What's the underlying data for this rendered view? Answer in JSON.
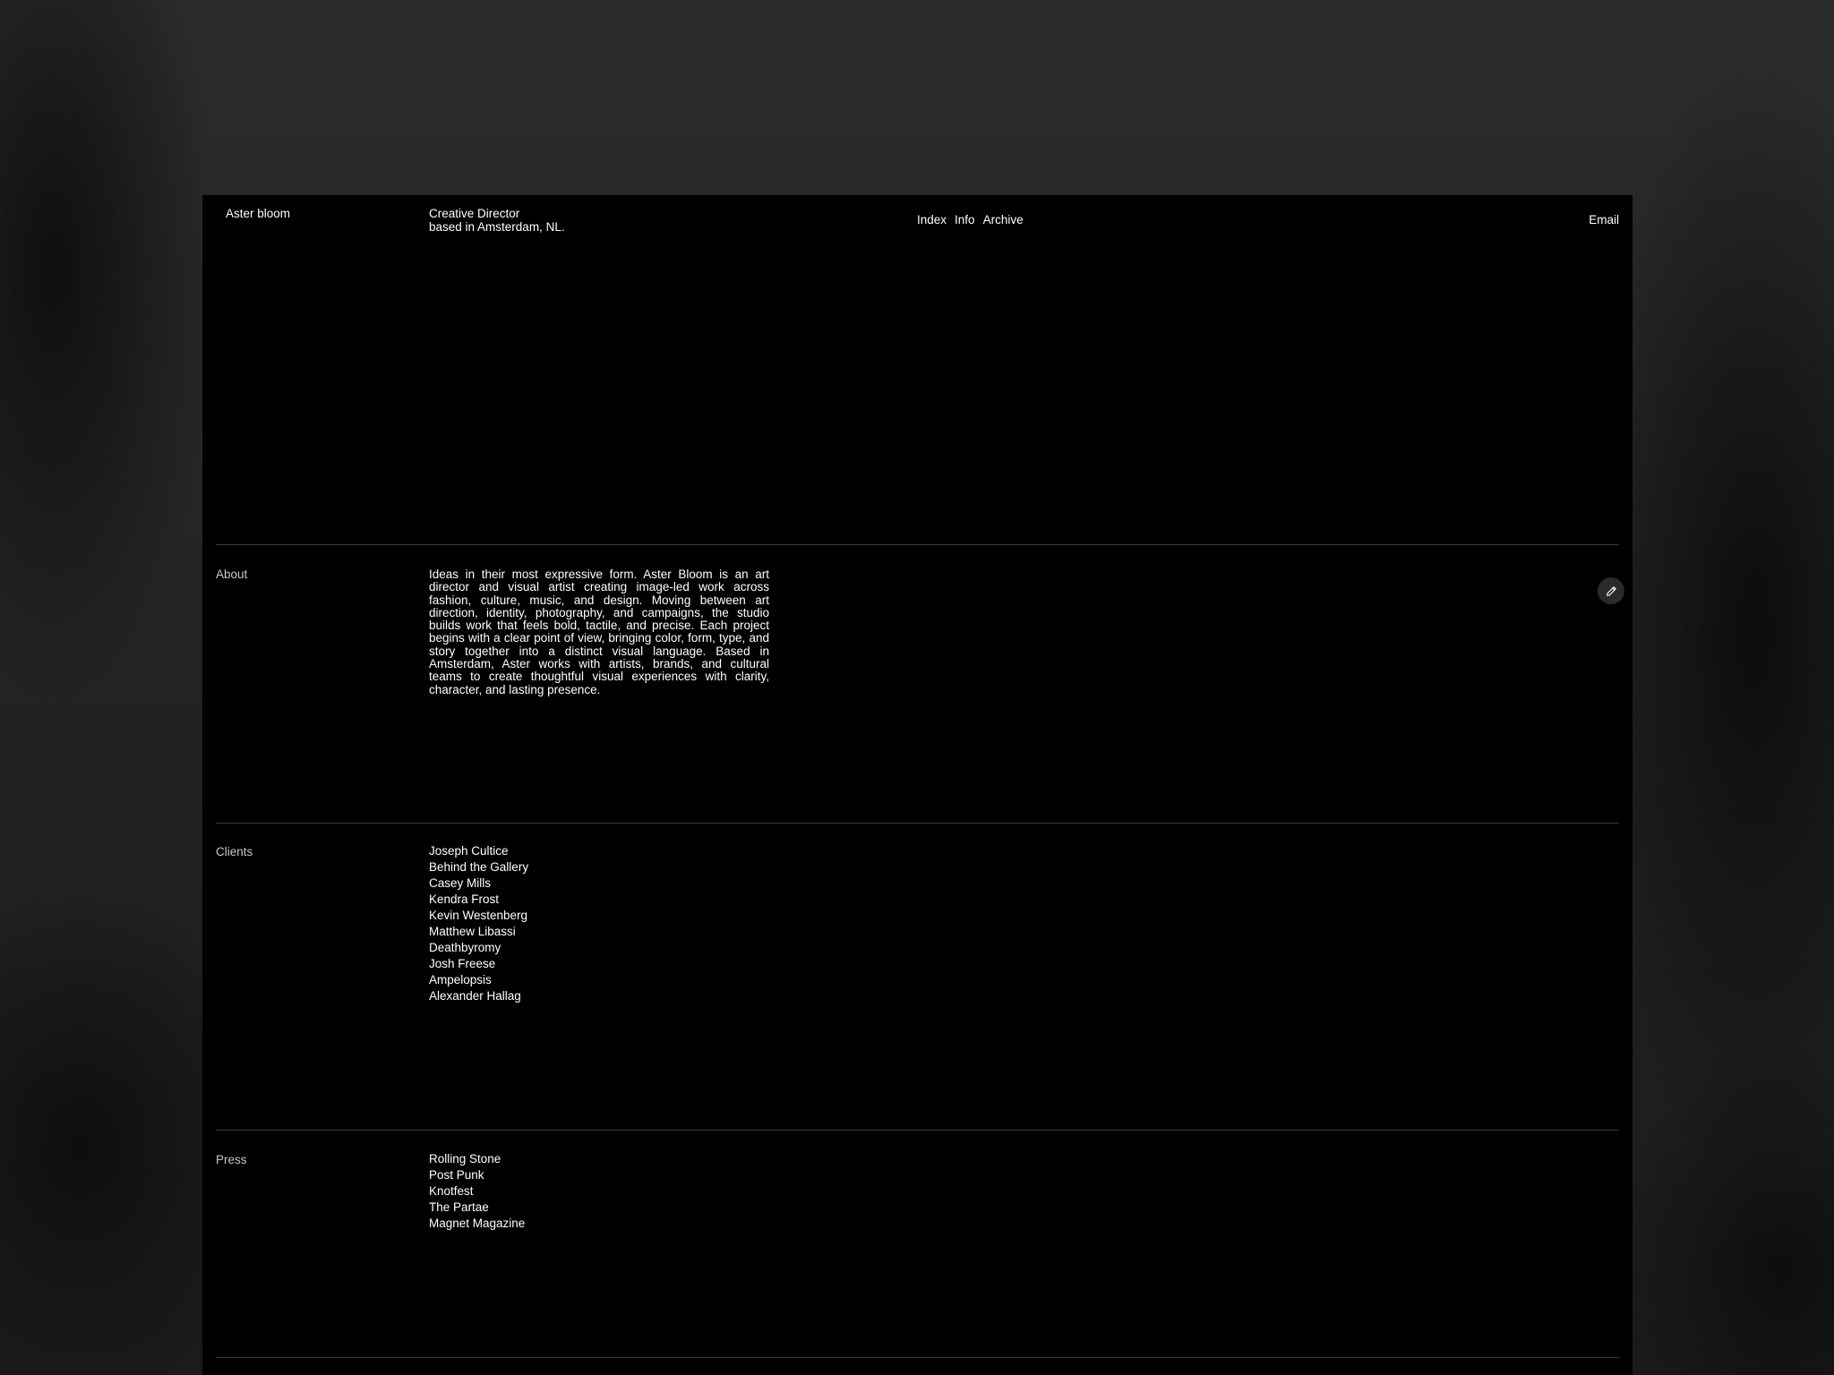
{
  "header": {
    "brand": "Aster bloom",
    "role_line1": "Creative Director",
    "role_line2": "based in Amsterdam, NL.",
    "nav": [
      "Index",
      "Info",
      "Archive"
    ],
    "email_label": "Email"
  },
  "about": {
    "label": "About",
    "text": "Ideas in their most expressive form. Aster Bloom is an art director and visual artist creating image-led work across fashion, culture, music, and design. Moving between art direction, identity, photography, and campaigns, the studio builds work that feels bold, tactile, and precise. Each project begins with a clear point of view, bringing color, form, type, and story together into a distinct visual language.  Based in Amsterdam, Aster works with artists, brands, and cultural teams to create thoughtful visual experiences with clarity, character, and lasting presence.",
    "edit_icon": "pencil-icon"
  },
  "clients": {
    "label": "Clients",
    "items": [
      "Joseph Cultice",
      "Behind the Gallery",
      "Casey Mills",
      "Kendra Frost",
      "Kevin Westenberg",
      "Matthew Libassi",
      "Deathbyromy",
      "Josh Freese",
      "Ampelopsis",
      "Alexander Hallag"
    ]
  },
  "press": {
    "label": "Press",
    "items": [
      "Rolling Stone",
      "Post Punk",
      "Knotfest",
      "The Partae",
      "Magnet Magazine"
    ]
  },
  "colors": {
    "panel": "#000000",
    "text": "#ffffff",
    "rule": "#3a3a3a",
    "backdrop": "#2a2a2a"
  }
}
